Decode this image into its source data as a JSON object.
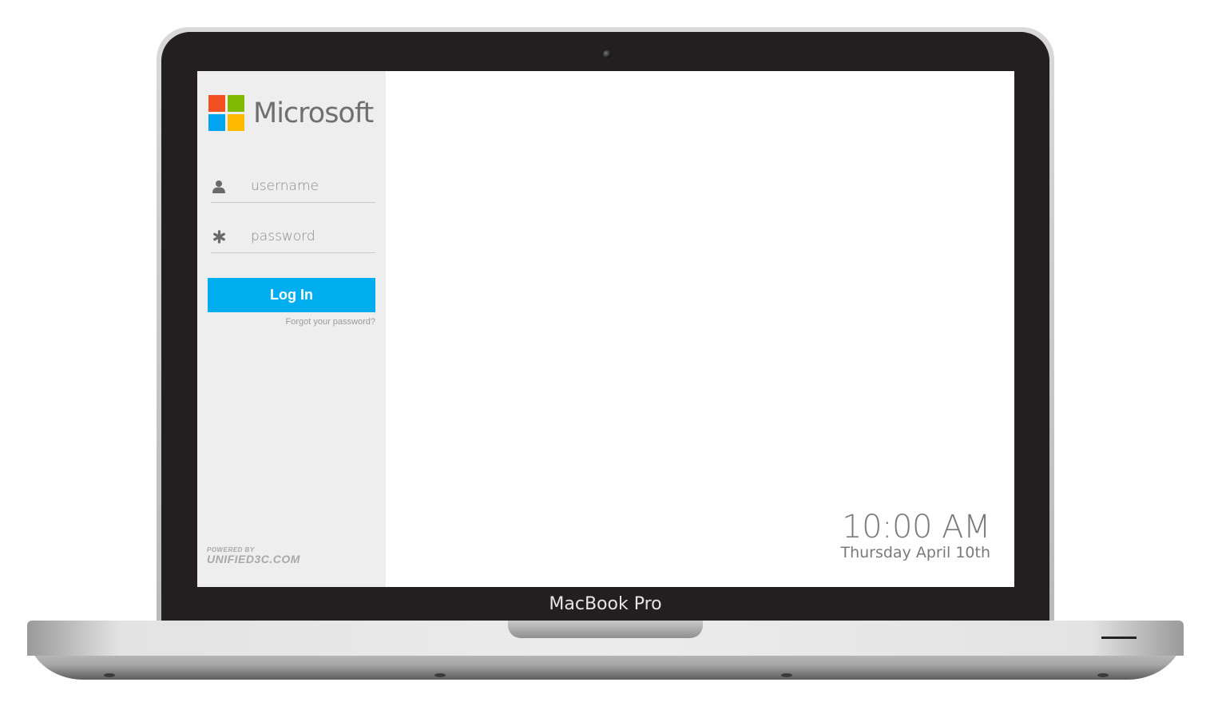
{
  "device": {
    "label": "MacBook Pro"
  },
  "brand": {
    "name": "Microsoft",
    "logo_colors": [
      "#f25022",
      "#7fba00",
      "#00a4ef",
      "#ffb900"
    ]
  },
  "login": {
    "username_placeholder": "username",
    "password_placeholder": "password",
    "login_label": "Log In",
    "forgot_label": "Forgot your password?",
    "accent_color": "#00aeef",
    "username_icon": "user-icon",
    "password_icon": "asterisk-icon"
  },
  "footer": {
    "powered_by": "POWERED BY",
    "provider": "UNIFIED3C.COM"
  },
  "clock": {
    "time": "10:00 AM",
    "date": "Thursday April 10th"
  }
}
